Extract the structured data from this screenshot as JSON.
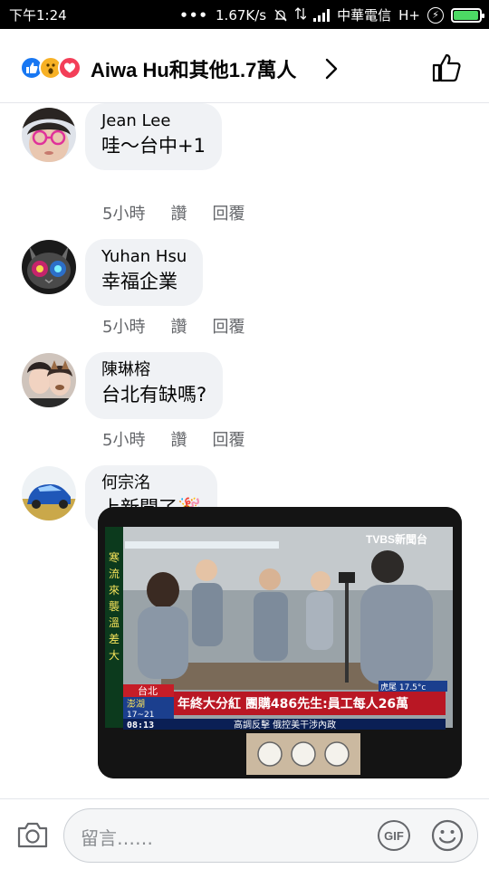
{
  "status_bar": {
    "time": "下午1:24",
    "dots": "•••",
    "speed": "1.67K/s",
    "network_type": "4G",
    "carrier": "中華電信",
    "data_type": "H+",
    "battery_level": 0.95
  },
  "reactions": {
    "icons": [
      "like-icon",
      "wow-icon",
      "love-icon"
    ],
    "summary": "Aiwa Hu和其他1.7萬人"
  },
  "comments": [
    {
      "name": "Jean Lee",
      "text": "哇～台中+1",
      "time": "5小時",
      "like": "讚",
      "reply": "回覆"
    },
    {
      "name": "Yuhan Hsu",
      "text": "幸福企業",
      "time": "5小時",
      "like": "讚",
      "reply": "回覆"
    },
    {
      "name": "陳琳榕",
      "text": "台北有缺嗎?",
      "time": "5小時",
      "like": "讚",
      "reply": "回覆"
    },
    {
      "name": "何宗洺",
      "text": "上新聞了",
      "emoji": "🎉"
    }
  ],
  "news_image": {
    "channel": "TVBS新聞台",
    "ticker_left": "台北",
    "ticker_place": "澎湖",
    "ticker_temp": "17~21",
    "headline": "年終大分紅 團購486先生:員工每人26萬",
    "subline": "高調反擊 俄控美干涉內政",
    "clock": "08:13",
    "weather": "虎尾 17.5°c",
    "side_caption": "寒流來襲溫差大"
  },
  "composer": {
    "placeholder": "留言……",
    "gif_label": "GIF"
  },
  "colors": {
    "bubble": "#f0f2f5",
    "meta_text": "#65676b",
    "like_blue": "#1877f2",
    "love_red": "#f33e58",
    "wow_yellow": "#f7b125"
  }
}
